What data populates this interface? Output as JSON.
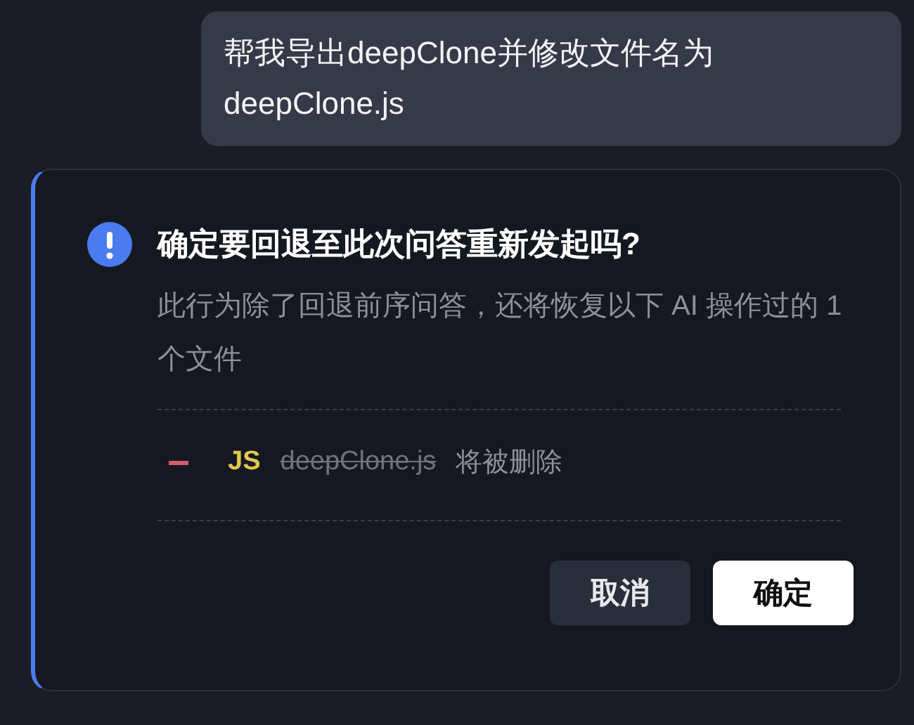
{
  "user_message": "帮我导出deepClone并修改文件名为deepClone.js",
  "dialog": {
    "title": "确定要回退至此次问答重新发起吗?",
    "description": "此行为除了回退前序问答，还将恢复以下 AI 操作过的 1 个文件",
    "files": [
      {
        "deleted": true,
        "type_label": "JS",
        "name": "deepClone.js",
        "note": "将被删除"
      }
    ],
    "buttons": [
      {
        "label": "取消",
        "kind": "secondary"
      },
      {
        "label": "确定",
        "kind": "primary"
      }
    ]
  }
}
